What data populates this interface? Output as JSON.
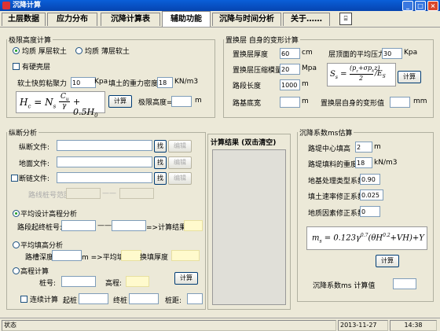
{
  "app": {
    "title": "沉降计算"
  },
  "tabs": [
    {
      "label": "土层数据"
    },
    {
      "label": "应力分布"
    },
    {
      "label": "沉降计算表"
    },
    {
      "label": "辅助功能"
    },
    {
      "label": "沉降与时间分析"
    },
    {
      "label": "关于……"
    }
  ],
  "limit_height": {
    "title": "极限高度计算",
    "radio1": "均质 厚层软土",
    "radio2": "均质 薄层软土",
    "hard_crust": "有硬壳层",
    "cohesion_label": "软土快剪粘聚力",
    "cohesion_value": "10",
    "cohesion_unit": "Kpa",
    "density_label": "填土的重力密度",
    "density_value": "18",
    "density_unit": "KN/m3",
    "calc_button": "计算",
    "result_label": "极限高度=",
    "result_unit": "m"
  },
  "crust_deform": {
    "title": "置换层 自身的变形计算",
    "thickness_label": "置换层厚度",
    "thickness_value": "60",
    "thickness_unit": "cm",
    "avg_pressure_label": "层顶面的平均压力",
    "avg_pressure_value": "30",
    "avg_pressure_unit": "Kpa",
    "modulus_label": "置换层压缩模量",
    "modulus_value": "20",
    "modulus_unit": "Mpa",
    "slope_label": "路段长度",
    "slope_value": "1000",
    "slope_unit": "m",
    "calc_button": "计算",
    "width_label": "路基底宽",
    "width_unit": "m",
    "self_deform_label": "置换层自身的变形值",
    "self_deform_unit": "mm"
  },
  "section": {
    "title": "纵断分析",
    "long_file": "纵断文件:",
    "ground_file": "地面文件:",
    "break_file": "断链文件:",
    "browse": "找",
    "edit": "编辑",
    "station_range": "路线桩号范围:",
    "dash": "——",
    "opt_avg_design": "平均设计高程分析",
    "start_end": "路段起终桩号:",
    "to_result": "=>计算结果",
    "opt_avg_fill": "平均填高分析",
    "trench_depth": "路槽深度",
    "trench_unit": "m =>平均填高",
    "replace_thickness": "换填厚度",
    "opt_elev": "高程计算",
    "pile_no": "桩号:",
    "elev": "高程:",
    "calc_button": "计算",
    "continuous": "连续计算",
    "start_pile": "起桩",
    "end_pile": "终桩",
    "pile_dist": "桩距:"
  },
  "result_panel": {
    "title": "计算结果 (双击清空)"
  },
  "ms_coef": {
    "title": "沉降系数ms估算",
    "center_fill": "路堤中心填高",
    "center_fill_value": "2",
    "center_fill_unit": "m",
    "unit_weight": "路堤填料的重度",
    "unit_weight_value": "18",
    "unit_weight_unit": "kN/m3",
    "treatment": "地基处理类型系数",
    "treatment_value": "0.90",
    "rate": "填土速率修正系数",
    "rate_value": "0.025",
    "geology": "地质因素修正系数",
    "geology_value": "0",
    "calc_button": "计算",
    "result_label": "沉降系数ms 计算值"
  },
  "status": {
    "state": "状态",
    "date": "2013-11-27",
    "time": "14:38"
  }
}
